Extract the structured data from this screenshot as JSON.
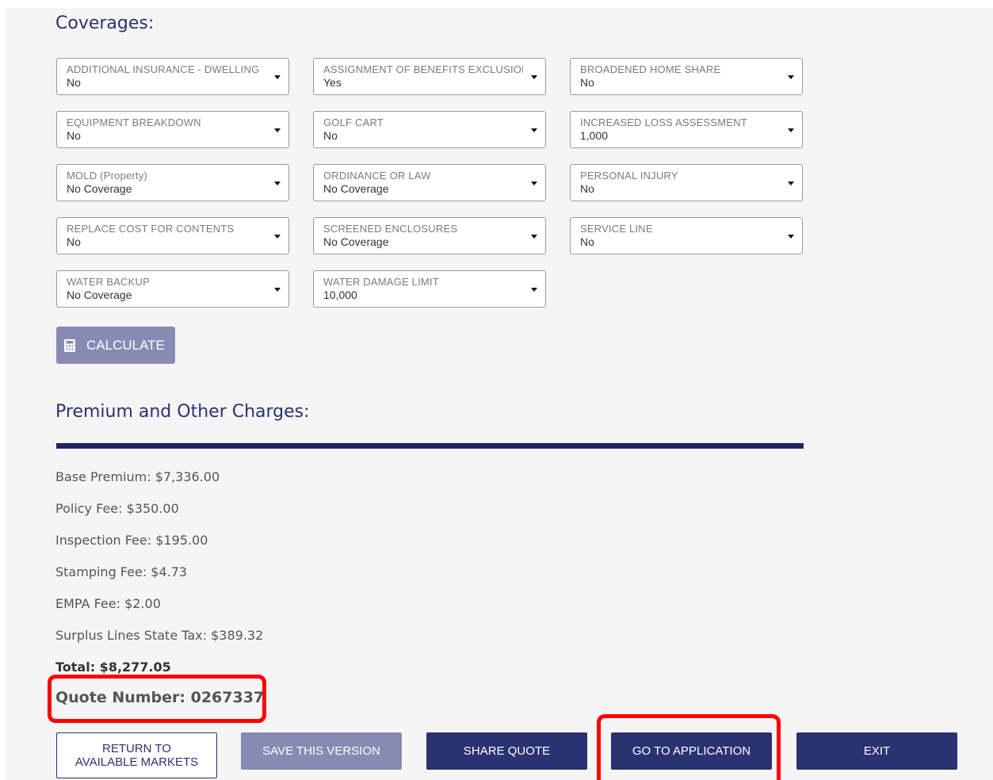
{
  "coverages": {
    "title": "Coverages:",
    "fields": [
      {
        "label": "ADDITIONAL INSURANCE - DWELLING",
        "value": "No"
      },
      {
        "label": "ASSIGNMENT OF BENEFITS EXCLUSION",
        "value": "Yes"
      },
      {
        "label": "BROADENED HOME SHARE",
        "value": "No"
      },
      {
        "label": "EQUIPMENT BREAKDOWN",
        "value": "No"
      },
      {
        "label": "GOLF CART",
        "value": "No"
      },
      {
        "label": "INCREASED LOSS ASSESSMENT",
        "value": "1,000"
      },
      {
        "label": "MOLD (Property)",
        "value": "No Coverage"
      },
      {
        "label": "ORDINANCE OR LAW",
        "value": "No Coverage"
      },
      {
        "label": "PERSONAL INJURY",
        "value": "No"
      },
      {
        "label": "REPLACE COST FOR CONTENTS",
        "value": "No"
      },
      {
        "label": "SCREENED ENCLOSURES",
        "value": "No Coverage"
      },
      {
        "label": "SERVICE LINE",
        "value": "No"
      },
      {
        "label": "WATER BACKUP",
        "value": "No Coverage"
      },
      {
        "label": "WATER DAMAGE LIMIT",
        "value": "10,000"
      }
    ],
    "calculate_label": "CALCULATE"
  },
  "premium": {
    "title": "Premium and Other Charges:",
    "lines": [
      "Base Premium: $7,336.00",
      "Policy Fee: $350.00",
      "Inspection Fee: $195.00",
      "Stamping Fee: $4.73",
      "EMPA Fee: $2.00",
      "Surplus Lines State Tax: $389.32"
    ],
    "total": "Total: $8,277.05",
    "quote_number": "Quote Number: 0267337"
  },
  "actions": {
    "return_line1": "RETURN TO",
    "return_line2": "AVAILABLE MARKETS",
    "save_version": "SAVE THIS VERSION",
    "share_quote": "SHARE QUOTE",
    "go_to_application": "GO TO APPLICATION",
    "exit": "EXIT"
  },
  "colors": {
    "accent": "#2b3272",
    "disabled_button": "#878bb3",
    "highlight": "#ff0000"
  }
}
